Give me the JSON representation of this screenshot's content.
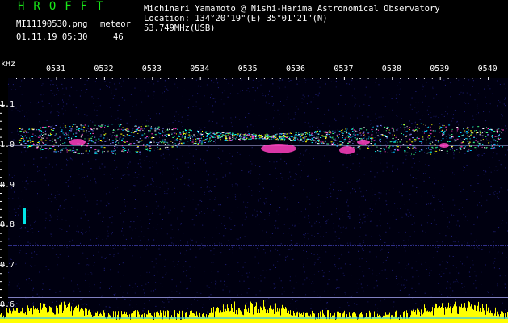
{
  "header": {
    "logo": "HROFFT",
    "filename": "MI11190530.png",
    "datetime": "01.11.19 05:30",
    "count_label": "meteor",
    "count_value": "46",
    "observer": "Michinari Yamamoto @ Nishi-Harima Astronomical Observatory",
    "location": "Location: 134°20'19\"(E) 35°01'21\"(N)",
    "frequency": "53.749MHz(USB)"
  },
  "chart_data": {
    "type": "heatmap",
    "y_unit": "kHz",
    "x_ticks": [
      "0531",
      "0532",
      "0533",
      "0534",
      "0535",
      "0536",
      "0537",
      "0538",
      "0539",
      "0540"
    ],
    "y_ticks": [
      "1.1",
      "1.0",
      "0.9",
      "0.8",
      "0.7",
      "0.6"
    ],
    "ylim": [
      0.6,
      1.1
    ],
    "colors": {
      "background": "#000010",
      "noise": "#1a1a8c",
      "signal_high": "#ff40c0",
      "signal_mid": "#00ffff",
      "bottom_bars": "#ffff00",
      "reference_line": "#6060ff",
      "grid": "#ffffff"
    }
  }
}
